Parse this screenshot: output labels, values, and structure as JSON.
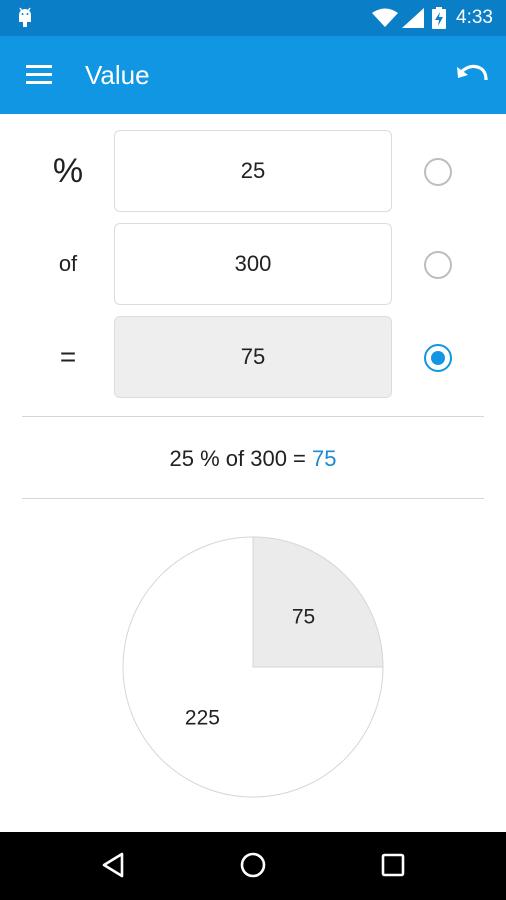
{
  "status_bar": {
    "time": "4:33"
  },
  "app_bar": {
    "title": "Value"
  },
  "rows": [
    {
      "label": "%",
      "value": "25",
      "selected": false
    },
    {
      "label": "of",
      "value": "300",
      "selected": false
    },
    {
      "label": "=",
      "value": "75",
      "selected": true
    }
  ],
  "equation": {
    "expression": "25 % of 300 = ",
    "result": "75"
  },
  "chart_data": {
    "type": "pie",
    "slices": [
      {
        "label": "75",
        "value": 75,
        "color": "#ebebeb"
      },
      {
        "label": "225",
        "value": 225,
        "color": "#ffffff"
      }
    ]
  },
  "colors": {
    "primary": "#1196e4",
    "status_bar": "#0a7fc7",
    "accent_text": "#1b8ad6"
  },
  "icons": {
    "menu": "hamburger-icon",
    "undo": "undo-icon",
    "back": "back-triangle-icon",
    "home": "home-circle-icon",
    "recents": "recents-square-icon"
  }
}
